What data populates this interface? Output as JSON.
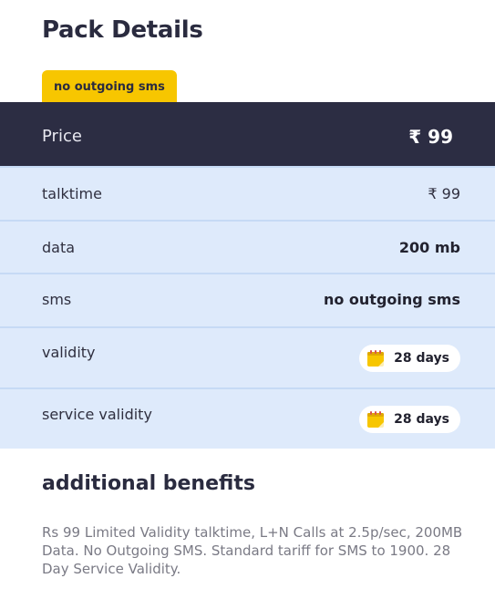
{
  "header": {
    "title": "Pack Details",
    "tag": "no outgoing sms"
  },
  "price": {
    "label": "Price",
    "value": "₹ 99"
  },
  "rows": [
    {
      "label": "talktime",
      "value": "₹ 99"
    },
    {
      "label": "data",
      "value": "200 mb"
    },
    {
      "label": "sms",
      "value": "no outgoing sms"
    },
    {
      "label": "validity",
      "value": "28 days",
      "icon": "calendar-icon"
    },
    {
      "label": "service validity",
      "value": "28 days",
      "icon": "calendar-icon"
    }
  ],
  "benefits": {
    "title": "additional benefits",
    "text": "Rs 99 Limited Validity talktime, L+N Calls at 2.5p/sec, 200MB Data. No Outgoing SMS. Standard tariff for SMS to 1900. 28 Day Service Validity."
  },
  "colors": {
    "accent": "#f7c600",
    "price_bar": "#2c2d43",
    "row_bg": "#deeafb"
  }
}
